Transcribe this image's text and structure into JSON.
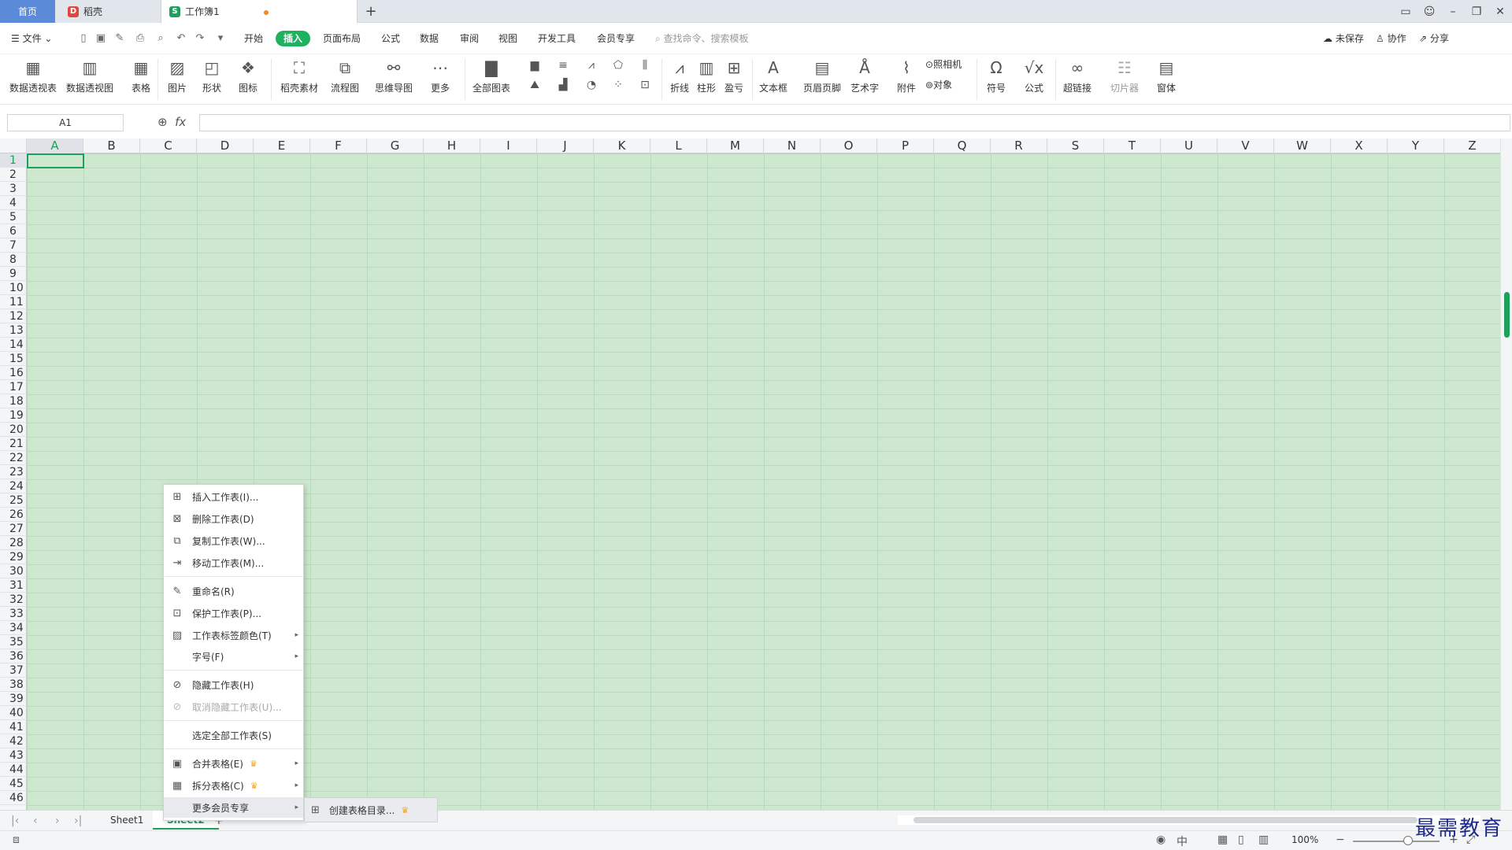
{
  "tabs": {
    "home": "首页",
    "daoke": "稻壳",
    "workbook": "工作簿1"
  },
  "menubar": {
    "file": "文件",
    "tabs": [
      "开始",
      "插入",
      "页面布局",
      "公式",
      "数据",
      "审阅",
      "视图",
      "开发工具",
      "会员专享"
    ],
    "active_tab": "插入",
    "search_placeholder": "查找命令、搜索模板",
    "unsaved": "未保存",
    "collab": "协作",
    "share": "分享"
  },
  "ribbon": {
    "pivot_table": "数据透视表",
    "pivot_chart": "数据透视图",
    "table": "表格",
    "picture": "图片",
    "shape": "形状",
    "icon": "图标",
    "daoke_material": "稻壳素材",
    "flowchart": "流程图",
    "mindmap": "思维导图",
    "more": "更多",
    "all_charts": "全部图表",
    "line": "折线",
    "column": "柱形",
    "winloss": "盈亏",
    "textbox": "文本框",
    "header_footer": "页眉页脚",
    "wordart": "艺术字",
    "attachment": "附件",
    "camera": "照相机",
    "object": "对象",
    "symbol": "符号",
    "formula": "公式",
    "hyperlink": "超链接",
    "slicer": "切片器",
    "window": "窗体"
  },
  "formula_bar": {
    "name_box": "A1",
    "fx": "fx"
  },
  "columns": [
    "A",
    "B",
    "C",
    "D",
    "E",
    "F",
    "G",
    "H",
    "I",
    "J",
    "K",
    "L",
    "M",
    "N",
    "O",
    "P",
    "Q",
    "R",
    "S",
    "T",
    "U",
    "V",
    "W",
    "X",
    "Y",
    "Z"
  ],
  "rows": [
    "1",
    "2",
    "3",
    "4",
    "5",
    "6",
    "7",
    "8",
    "9",
    "10",
    "11",
    "12",
    "13",
    "14",
    "15",
    "16",
    "17",
    "18",
    "19",
    "20",
    "21",
    "22",
    "23",
    "24",
    "25",
    "26",
    "27",
    "28",
    "29",
    "30",
    "31",
    "32",
    "33",
    "34",
    "35",
    "36",
    "37",
    "38",
    "39",
    "40",
    "41",
    "42",
    "43",
    "44",
    "45",
    "46"
  ],
  "context_menu": {
    "insert": "插入工作表(I)...",
    "delete": "删除工作表(D)",
    "copy": "复制工作表(W)...",
    "move": "移动工作表(M)...",
    "rename": "重命名(R)",
    "protect": "保护工作表(P)...",
    "tab_color": "工作表标签颜色(T)",
    "font_size": "字号(F)",
    "hide": "隐藏工作表(H)",
    "unhide": "取消隐藏工作表(U)...",
    "select_all": "选定全部工作表(S)",
    "merge": "合并表格(E)",
    "split": "拆分表格(C)",
    "more_vip": "更多会员专享"
  },
  "submenu": {
    "create_toc": "创建表格目录..."
  },
  "sheets": [
    "Sheet1",
    "Sheet2"
  ],
  "active_sheet": "Sheet2",
  "status": {
    "zoom": "100%"
  },
  "watermark": "最需教育",
  "colors": {
    "accent": "#1fa05a",
    "cell_bg": "#cde8cf",
    "home_tab": "#5b8bd8"
  }
}
